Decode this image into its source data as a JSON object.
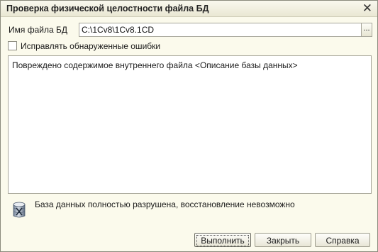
{
  "window": {
    "title": "Проверка физической целостности файла БД"
  },
  "form": {
    "db_file_label": "Имя файла БД",
    "db_file_value": "C:\\1Cv8\\1Cv8.1CD",
    "browse_label": "...",
    "fix_errors_label": "Исправлять обнаруженные ошибки",
    "fix_errors_checked": false
  },
  "log": {
    "lines": [
      "Повреждено содержимое внутреннего файла <Описание базы данных>"
    ]
  },
  "status": {
    "text": "База данных полностью разрушена, восстановление невозможно",
    "icon": "database-cross-icon"
  },
  "buttons": {
    "run": "Выполнить",
    "close": "Закрыть",
    "help": "Справка"
  }
}
